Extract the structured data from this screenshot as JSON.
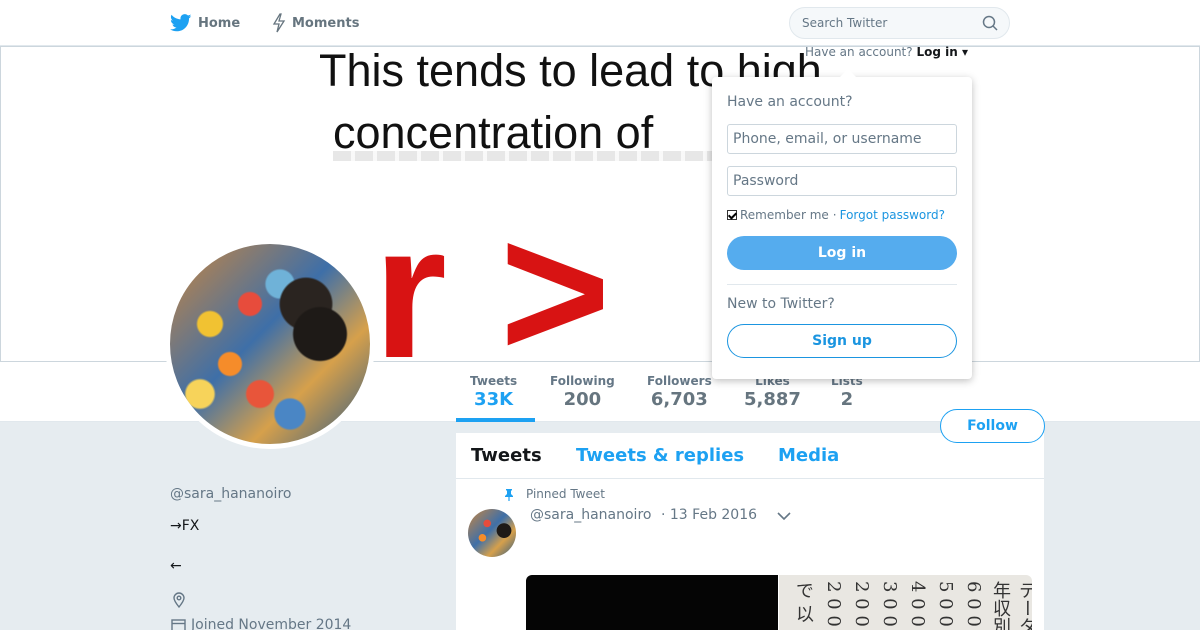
{
  "nav": {
    "home_label": "Home",
    "moments_label": "Moments",
    "search_placeholder": "Search Twitter"
  },
  "banner": {
    "line1": "This tends to lead to high",
    "line2": "concentration of",
    "graphic_text": "r >"
  },
  "account_hint": {
    "prefix": "Have an account?",
    "login_label": "Log in"
  },
  "login_dropdown": {
    "title": "Have an account?",
    "username_placeholder": "Phone, email, or username",
    "password_placeholder": "Password",
    "remember_label": "Remember me",
    "separator": "·",
    "forgot_label": "Forgot password?",
    "login_button": "Log in",
    "new_label": "New to Twitter?",
    "signup_button": "Sign up"
  },
  "stats": [
    {
      "label": "Tweets",
      "value": "33K"
    },
    {
      "label": "Following",
      "value": "200"
    },
    {
      "label": "Followers",
      "value": "6,703"
    },
    {
      "label": "Likes",
      "value": "5,887"
    },
    {
      "label": "Lists",
      "value": "2"
    }
  ],
  "follow_label": "Follow",
  "profile": {
    "name": "",
    "handle": "@sara_hananoiro",
    "bio": "→FX",
    "arrow": "←",
    "joined": "Joined November 2014"
  },
  "timeline": {
    "tabs": [
      "Tweets",
      "Tweets & replies",
      "Media"
    ],
    "pinned_label": "Pinned Tweet",
    "tweet_handle": "@sara_hananoiro",
    "tweet_date": "· 13 Feb 2016"
  },
  "media_text": [
    "データ",
    "年収別",
    "6 0 0",
    "5 0 0",
    "4 0 0",
    "3 0 0",
    "2 0 0",
    "2 0 0",
    "で 以"
  ],
  "colors": {
    "accent": "#1da1f2",
    "login_button": "#55acee",
    "page_bg": "#e6ecf0"
  }
}
